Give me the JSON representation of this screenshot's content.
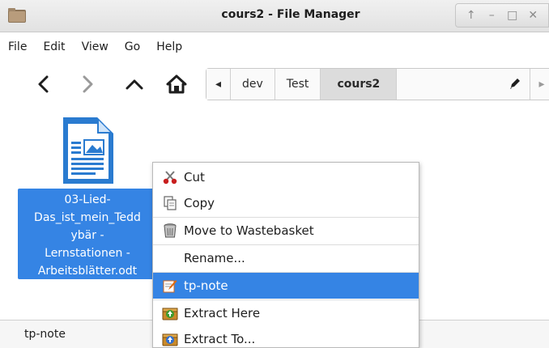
{
  "window": {
    "title": "cours2 - File Manager",
    "wm_buttons": [
      "↑",
      "–",
      "□",
      "✕"
    ]
  },
  "menu": [
    "File",
    "Edit",
    "View",
    "Go",
    "Help"
  ],
  "toolbar": {
    "back_icon": "chevron-left-icon",
    "forward_icon": "chevron-right-icon",
    "up_icon": "chevron-up-icon",
    "home_icon": "home-icon"
  },
  "pathbar": {
    "left_arrow": "◂",
    "segments": [
      "dev",
      "Test"
    ],
    "current": "cours2",
    "right_arrow": "▸"
  },
  "file": {
    "name_lines": [
      "03-Lied-",
      "Das_ist_mein_Tedd",
      "ybär -",
      "Lernstationen -",
      "Arbeitsblätter.odt"
    ]
  },
  "context_menu": {
    "items": [
      {
        "label": "Cut",
        "icon": "scissors-icon"
      },
      {
        "label": "Copy",
        "icon": "copy-icon"
      },
      {
        "label": "Move to Wastebasket",
        "icon": "trash-icon"
      },
      {
        "label": "Rename...",
        "icon": ""
      },
      {
        "label": "tp-note",
        "icon": "edit-note-icon",
        "selected": true
      },
      {
        "label": "Extract Here",
        "icon": "archive-extract-icon"
      },
      {
        "label": "Extract To...",
        "icon": "archive-extract-to-icon"
      }
    ]
  },
  "status": {
    "text": "tp-note"
  },
  "colors": {
    "selection": "#3584e4",
    "folder": "#a0876a",
    "doc_blue": "#2a7bd0"
  }
}
